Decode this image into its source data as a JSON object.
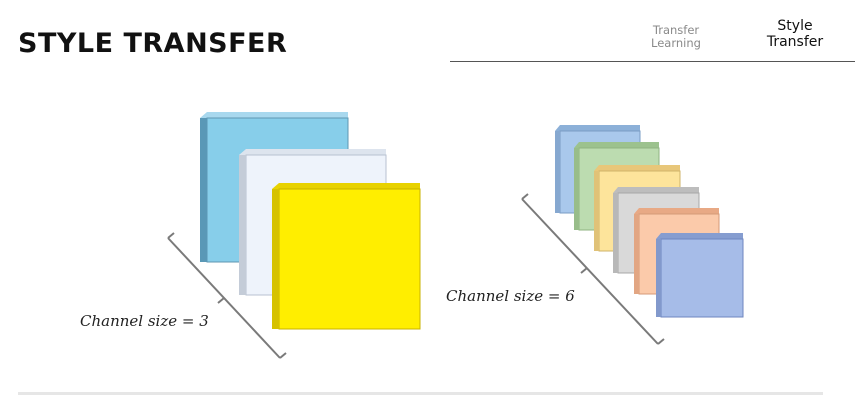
{
  "header": {
    "title": "STYLE TRANSFER"
  },
  "nav": {
    "tabs": [
      {
        "line1": "Transfer",
        "line2": "Learning",
        "active": false
      },
      {
        "line1": "Style",
        "line2": "Transfer",
        "active": true
      }
    ]
  },
  "figure": {
    "left_group": {
      "label": "Channel size = 3",
      "channels": 3,
      "colors": [
        "#87ceea",
        "#eef3fb",
        "#ffee00"
      ]
    },
    "right_group": {
      "label": "Channel size = 6",
      "channels": 6,
      "colors": [
        "#a9c8ec",
        "#bcdcb0",
        "#fde49b",
        "#d9d9d9",
        "#fbcaaa",
        "#a6bce8"
      ]
    }
  }
}
